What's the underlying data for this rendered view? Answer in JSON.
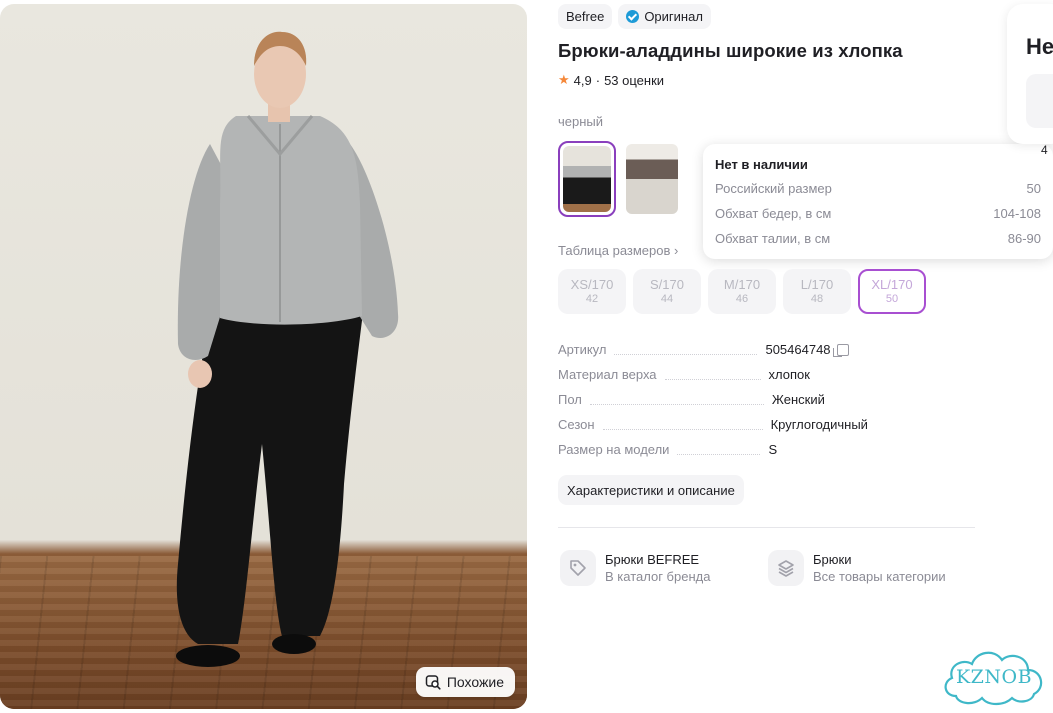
{
  "photo": {
    "similar_label": "Похожие"
  },
  "badges": {
    "brand": "Befree",
    "original": "Оригинал"
  },
  "title": "Брюки-аладдины широкие из хлопка",
  "rating": {
    "value": "4,9",
    "count": "53 оценки"
  },
  "color": {
    "label": "черный"
  },
  "size_table_link": "Таблица размеров ›",
  "sizes": [
    {
      "label": "XS/170",
      "ru": "42"
    },
    {
      "label": "S/170",
      "ru": "44"
    },
    {
      "label": "M/170",
      "ru": "46"
    },
    {
      "label": "L/170",
      "ru": "48"
    },
    {
      "label": "XL/170",
      "ru": "50",
      "selected": true
    }
  ],
  "tooltip": {
    "heading": "Нет в наличии",
    "rows": [
      {
        "k": "Российский размер",
        "v": "50"
      },
      {
        "k": "Обхват бедер, в см",
        "v": "104-108"
      },
      {
        "k": "Обхват талии, в см",
        "v": "86-90"
      }
    ]
  },
  "specs": [
    {
      "k": "Артикул",
      "v": "505464748"
    },
    {
      "k": "Материал верха",
      "v": "хлопок"
    },
    {
      "k": "Пол",
      "v": "Женский"
    },
    {
      "k": "Сезон",
      "v": "Круглогодичный"
    },
    {
      "k": "Размер на модели",
      "v": "S"
    }
  ],
  "characteristics_button": "Характеристики и описание",
  "links": [
    {
      "title": "Брюки BEFREE",
      "subtitle": "В каталог бренда",
      "icon": "tag-icon"
    },
    {
      "title": "Брюки",
      "subtitle": "Все товары категории",
      "icon": "layers-icon"
    }
  ],
  "right_panel": {
    "title": "Не",
    "fragment": "4"
  },
  "watermark": "KZNOB",
  "colors": {
    "accent": "#a84fd1",
    "star": "#f5883a",
    "muted": "#8b8b95",
    "verified": "#1e9bd7"
  }
}
